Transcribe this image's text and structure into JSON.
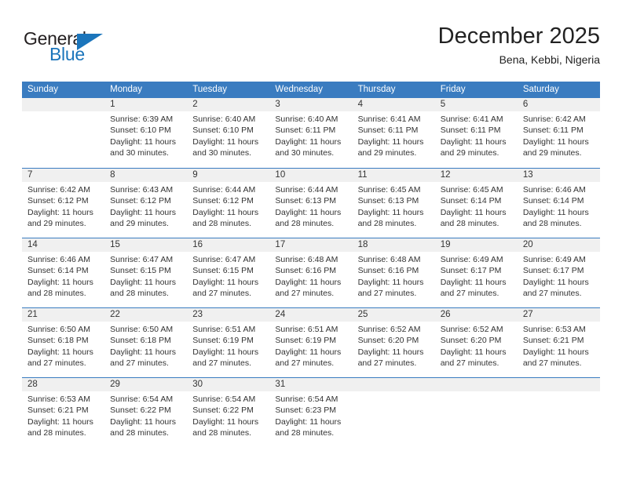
{
  "brand": {
    "name_top": "General",
    "name_bottom": "Blue",
    "accent_color": "#1b75bb"
  },
  "header": {
    "title": "December 2025",
    "subtitle": "Bena, Kebbi, Nigeria"
  },
  "calendar": {
    "header_bg": "#3a7cc0",
    "day_band_bg": "#f0f0f0",
    "weekdays": [
      "Sunday",
      "Monday",
      "Tuesday",
      "Wednesday",
      "Thursday",
      "Friday",
      "Saturday"
    ],
    "weeks": [
      [
        {
          "day": "",
          "lines": []
        },
        {
          "day": "1",
          "lines": [
            "Sunrise: 6:39 AM",
            "Sunset: 6:10 PM",
            "Daylight: 11 hours",
            "and 30 minutes."
          ]
        },
        {
          "day": "2",
          "lines": [
            "Sunrise: 6:40 AM",
            "Sunset: 6:10 PM",
            "Daylight: 11 hours",
            "and 30 minutes."
          ]
        },
        {
          "day": "3",
          "lines": [
            "Sunrise: 6:40 AM",
            "Sunset: 6:11 PM",
            "Daylight: 11 hours",
            "and 30 minutes."
          ]
        },
        {
          "day": "4",
          "lines": [
            "Sunrise: 6:41 AM",
            "Sunset: 6:11 PM",
            "Daylight: 11 hours",
            "and 29 minutes."
          ]
        },
        {
          "day": "5",
          "lines": [
            "Sunrise: 6:41 AM",
            "Sunset: 6:11 PM",
            "Daylight: 11 hours",
            "and 29 minutes."
          ]
        },
        {
          "day": "6",
          "lines": [
            "Sunrise: 6:42 AM",
            "Sunset: 6:11 PM",
            "Daylight: 11 hours",
            "and 29 minutes."
          ]
        }
      ],
      [
        {
          "day": "7",
          "lines": [
            "Sunrise: 6:42 AM",
            "Sunset: 6:12 PM",
            "Daylight: 11 hours",
            "and 29 minutes."
          ]
        },
        {
          "day": "8",
          "lines": [
            "Sunrise: 6:43 AM",
            "Sunset: 6:12 PM",
            "Daylight: 11 hours",
            "and 29 minutes."
          ]
        },
        {
          "day": "9",
          "lines": [
            "Sunrise: 6:44 AM",
            "Sunset: 6:12 PM",
            "Daylight: 11 hours",
            "and 28 minutes."
          ]
        },
        {
          "day": "10",
          "lines": [
            "Sunrise: 6:44 AM",
            "Sunset: 6:13 PM",
            "Daylight: 11 hours",
            "and 28 minutes."
          ]
        },
        {
          "day": "11",
          "lines": [
            "Sunrise: 6:45 AM",
            "Sunset: 6:13 PM",
            "Daylight: 11 hours",
            "and 28 minutes."
          ]
        },
        {
          "day": "12",
          "lines": [
            "Sunrise: 6:45 AM",
            "Sunset: 6:14 PM",
            "Daylight: 11 hours",
            "and 28 minutes."
          ]
        },
        {
          "day": "13",
          "lines": [
            "Sunrise: 6:46 AM",
            "Sunset: 6:14 PM",
            "Daylight: 11 hours",
            "and 28 minutes."
          ]
        }
      ],
      [
        {
          "day": "14",
          "lines": [
            "Sunrise: 6:46 AM",
            "Sunset: 6:14 PM",
            "Daylight: 11 hours",
            "and 28 minutes."
          ]
        },
        {
          "day": "15",
          "lines": [
            "Sunrise: 6:47 AM",
            "Sunset: 6:15 PM",
            "Daylight: 11 hours",
            "and 28 minutes."
          ]
        },
        {
          "day": "16",
          "lines": [
            "Sunrise: 6:47 AM",
            "Sunset: 6:15 PM",
            "Daylight: 11 hours",
            "and 27 minutes."
          ]
        },
        {
          "day": "17",
          "lines": [
            "Sunrise: 6:48 AM",
            "Sunset: 6:16 PM",
            "Daylight: 11 hours",
            "and 27 minutes."
          ]
        },
        {
          "day": "18",
          "lines": [
            "Sunrise: 6:48 AM",
            "Sunset: 6:16 PM",
            "Daylight: 11 hours",
            "and 27 minutes."
          ]
        },
        {
          "day": "19",
          "lines": [
            "Sunrise: 6:49 AM",
            "Sunset: 6:17 PM",
            "Daylight: 11 hours",
            "and 27 minutes."
          ]
        },
        {
          "day": "20",
          "lines": [
            "Sunrise: 6:49 AM",
            "Sunset: 6:17 PM",
            "Daylight: 11 hours",
            "and 27 minutes."
          ]
        }
      ],
      [
        {
          "day": "21",
          "lines": [
            "Sunrise: 6:50 AM",
            "Sunset: 6:18 PM",
            "Daylight: 11 hours",
            "and 27 minutes."
          ]
        },
        {
          "day": "22",
          "lines": [
            "Sunrise: 6:50 AM",
            "Sunset: 6:18 PM",
            "Daylight: 11 hours",
            "and 27 minutes."
          ]
        },
        {
          "day": "23",
          "lines": [
            "Sunrise: 6:51 AM",
            "Sunset: 6:19 PM",
            "Daylight: 11 hours",
            "and 27 minutes."
          ]
        },
        {
          "day": "24",
          "lines": [
            "Sunrise: 6:51 AM",
            "Sunset: 6:19 PM",
            "Daylight: 11 hours",
            "and 27 minutes."
          ]
        },
        {
          "day": "25",
          "lines": [
            "Sunrise: 6:52 AM",
            "Sunset: 6:20 PM",
            "Daylight: 11 hours",
            "and 27 minutes."
          ]
        },
        {
          "day": "26",
          "lines": [
            "Sunrise: 6:52 AM",
            "Sunset: 6:20 PM",
            "Daylight: 11 hours",
            "and 27 minutes."
          ]
        },
        {
          "day": "27",
          "lines": [
            "Sunrise: 6:53 AM",
            "Sunset: 6:21 PM",
            "Daylight: 11 hours",
            "and 27 minutes."
          ]
        }
      ],
      [
        {
          "day": "28",
          "lines": [
            "Sunrise: 6:53 AM",
            "Sunset: 6:21 PM",
            "Daylight: 11 hours",
            "and 28 minutes."
          ]
        },
        {
          "day": "29",
          "lines": [
            "Sunrise: 6:54 AM",
            "Sunset: 6:22 PM",
            "Daylight: 11 hours",
            "and 28 minutes."
          ]
        },
        {
          "day": "30",
          "lines": [
            "Sunrise: 6:54 AM",
            "Sunset: 6:22 PM",
            "Daylight: 11 hours",
            "and 28 minutes."
          ]
        },
        {
          "day": "31",
          "lines": [
            "Sunrise: 6:54 AM",
            "Sunset: 6:23 PM",
            "Daylight: 11 hours",
            "and 28 minutes."
          ]
        },
        {
          "day": "",
          "lines": []
        },
        {
          "day": "",
          "lines": []
        },
        {
          "day": "",
          "lines": []
        }
      ]
    ]
  }
}
